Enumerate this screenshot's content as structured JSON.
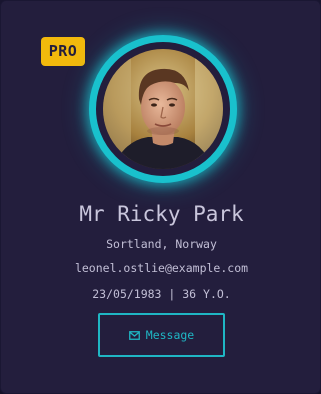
{
  "card": {
    "badge": "PRO",
    "name": "Mr Ricky Park",
    "location": "Sortland, Norway",
    "email": "leonel.ostlie@example.com",
    "dob_age": "23/05/1983 | 36 Y.O.",
    "message_button": {
      "label": "Message",
      "icon": "envelope-icon"
    },
    "avatar_alt": "profile photo"
  },
  "colors": {
    "background": "#1a1733",
    "card": "#231e3d",
    "accent": "#19c1cd",
    "badge": "#f2b90c",
    "text": "#c2bfd6"
  }
}
